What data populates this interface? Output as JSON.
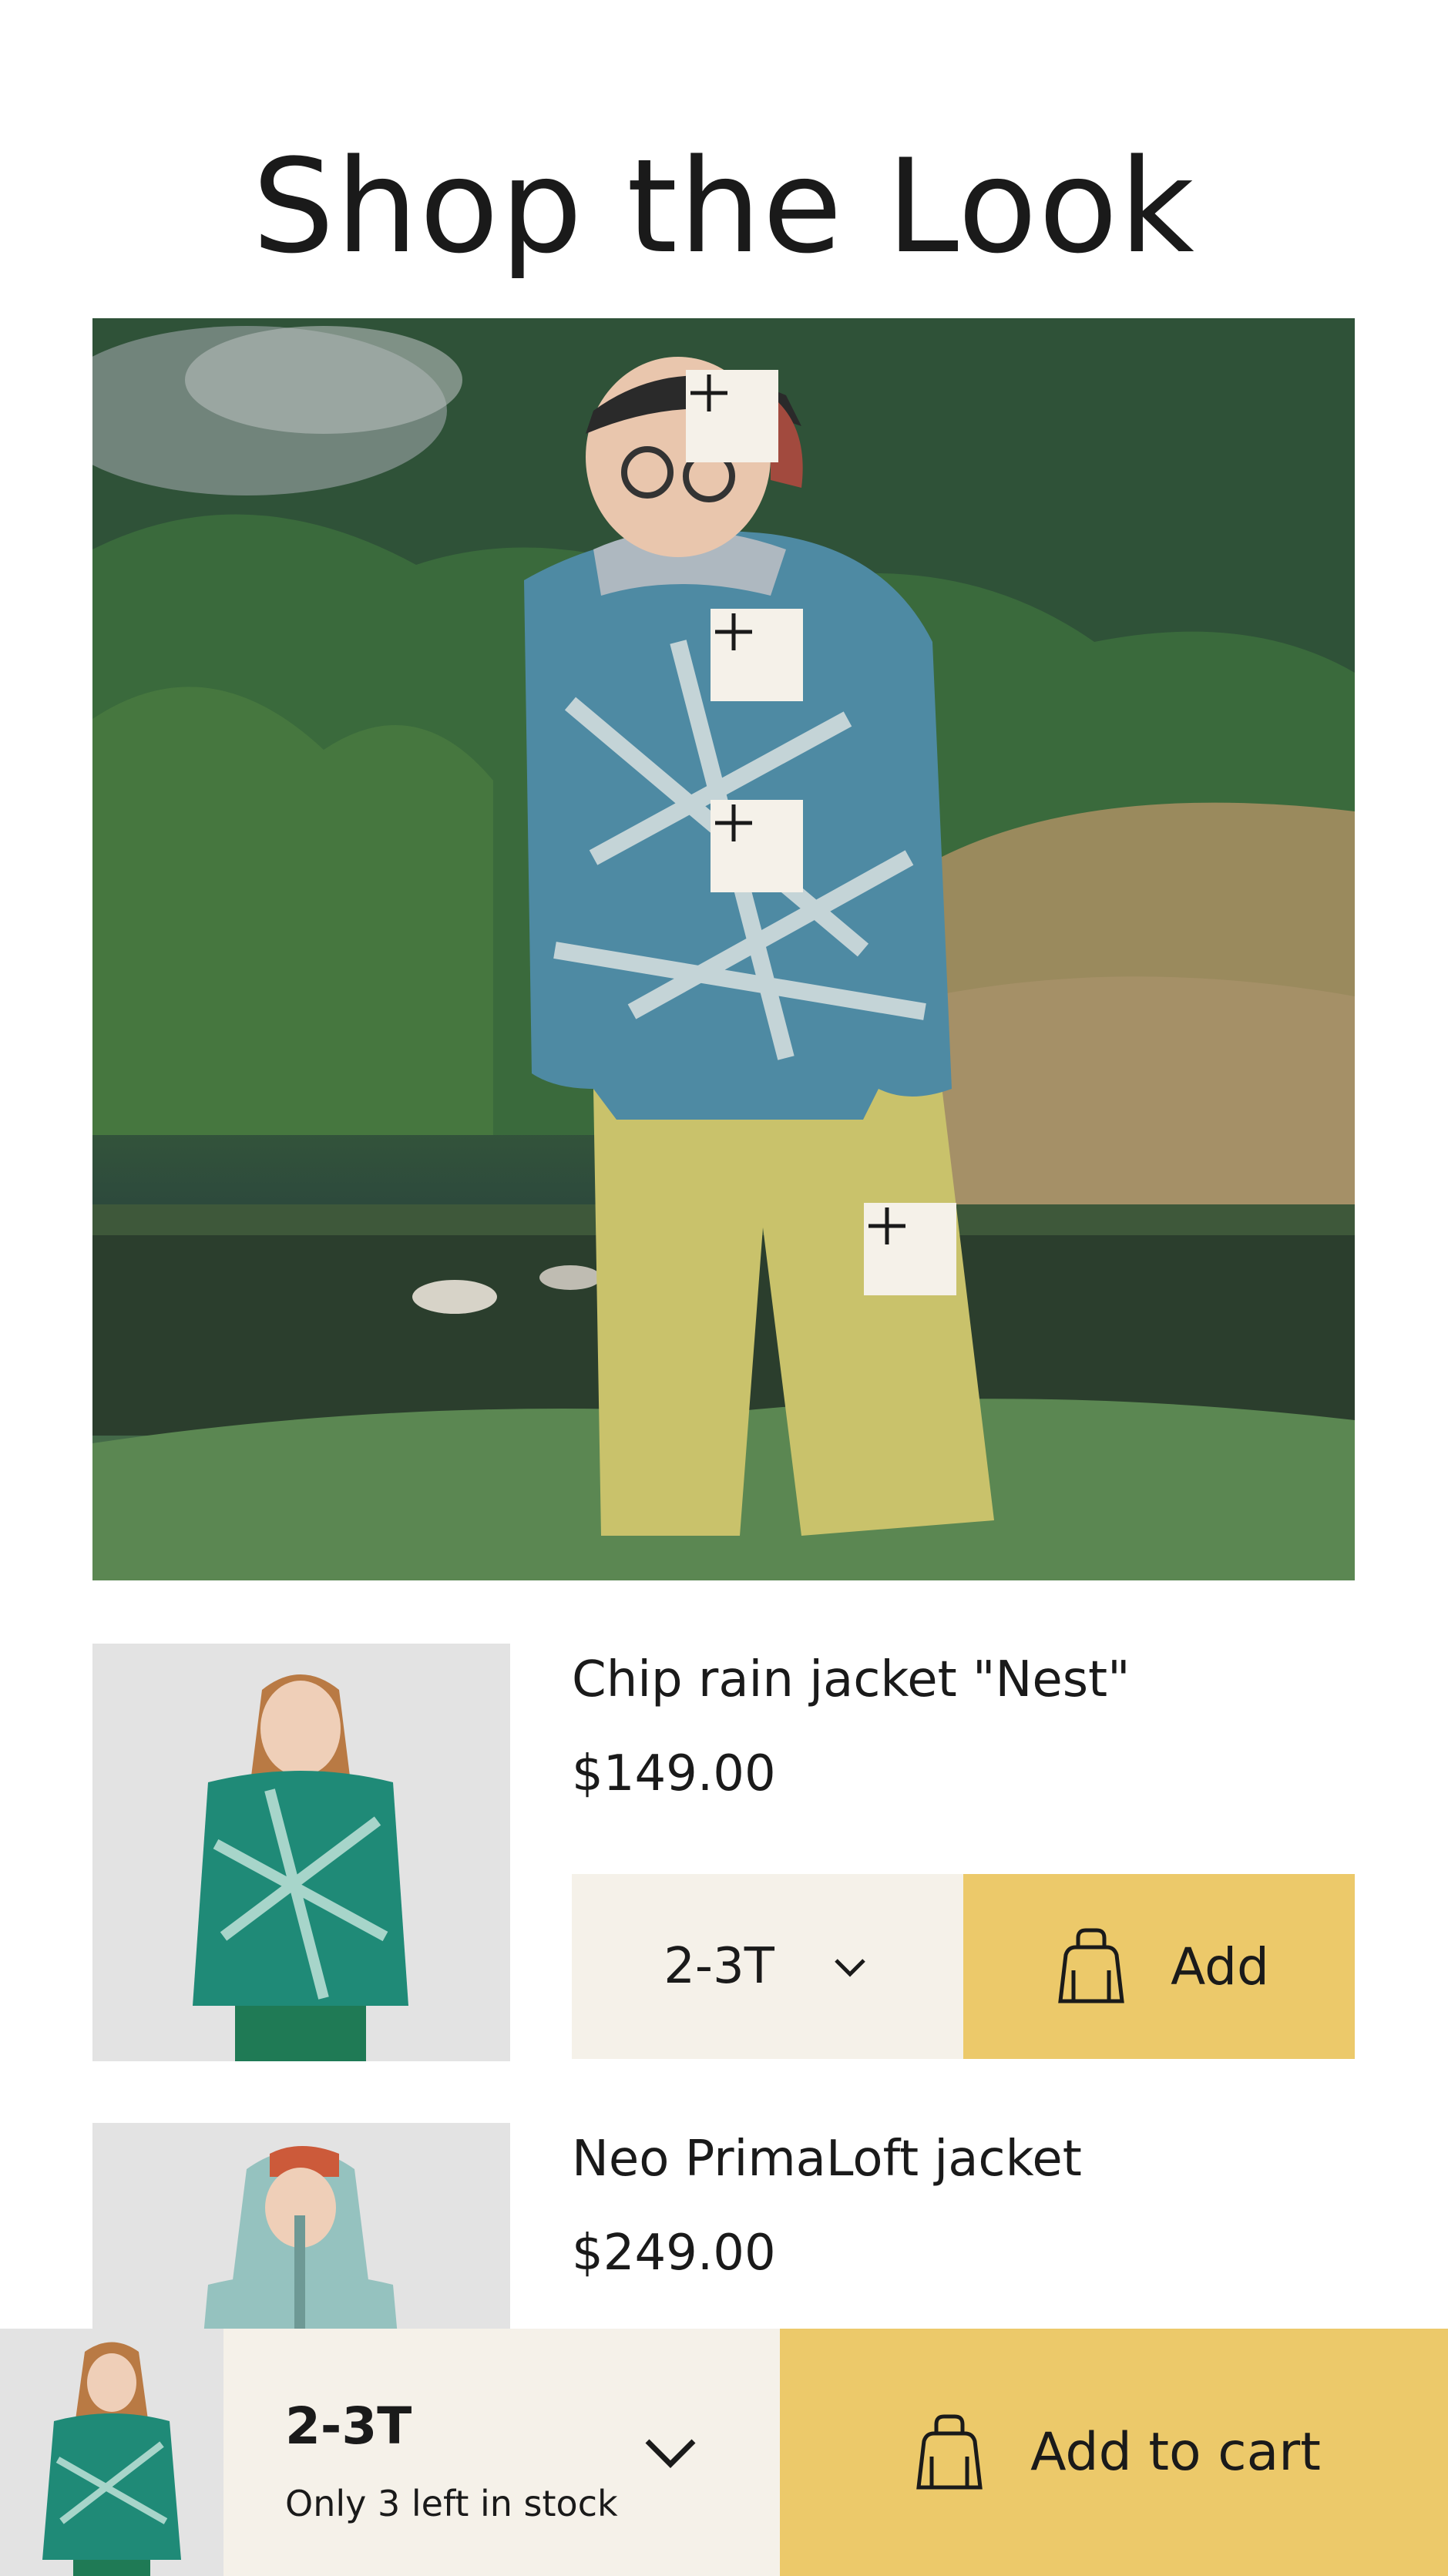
{
  "page": {
    "title": "Shop the Look"
  },
  "products": [
    {
      "name": "Chip rain jacket \"Nest\"",
      "price": "$149.00",
      "size": "2-3T",
      "add_label": "Add"
    },
    {
      "name": "Neo PrimaLoft jacket",
      "price": "$249.00"
    }
  ],
  "sticky_bar": {
    "size": "2-3T",
    "stock_note": "Only 3 left in stock",
    "add_label": "Add to cart"
  },
  "icons": {
    "hotspot": "plus-icon",
    "bag": "shopping-bag-icon",
    "dropdown": "chevron-down-icon"
  },
  "colors": {
    "accent": "#ecc96a",
    "panel": "#f5f1e9",
    "thumb_bg": "#e3e3e3",
    "text": "#1a1a1a"
  }
}
